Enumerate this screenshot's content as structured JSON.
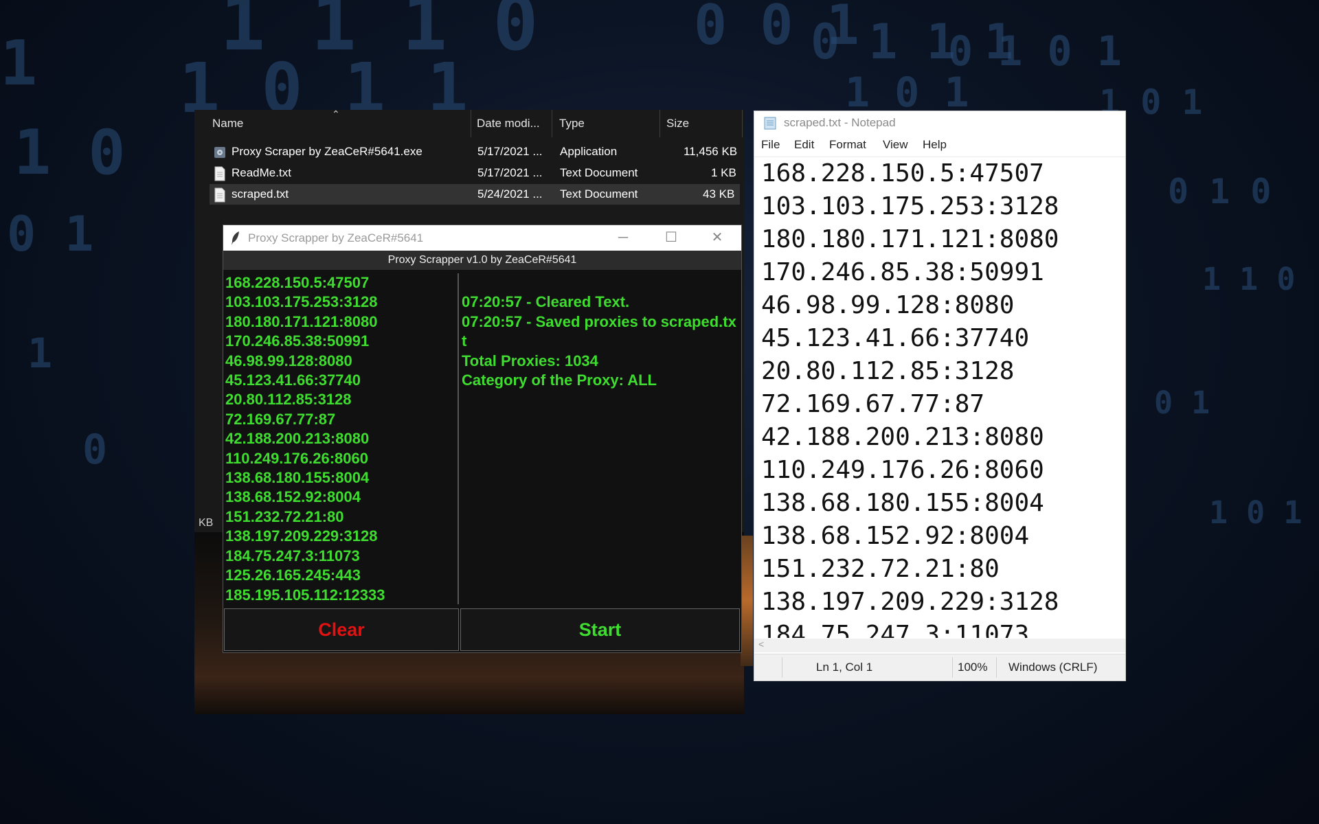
{
  "explorer": {
    "columns": [
      "Name",
      "Date modi...",
      "Type",
      "Size"
    ],
    "files": [
      {
        "name": "Proxy Scraper by ZeaCeR#5641.exe",
        "date": "5/17/2021 ...",
        "type": "Application",
        "size": "11,456 KB",
        "icon": "app-icon"
      },
      {
        "name": "ReadMe.txt",
        "date": "5/17/2021 ...",
        "type": "Text Document",
        "size": "1 KB",
        "icon": "text-file-icon"
      },
      {
        "name": "scraped.txt",
        "date": "5/24/2021 ...",
        "type": "Text Document",
        "size": "43 KB",
        "icon": "text-file-icon"
      }
    ],
    "partial_size": "KB"
  },
  "proxy_app": {
    "title": "Proxy Scrapper by ZeaCeR#5641",
    "subtitle": "Proxy Scrapper v1.0 by ZeaCeR#5641",
    "proxies": [
      "168.228.150.5:47507",
      "103.103.175.253:3128",
      "180.180.171.121:8080",
      "170.246.85.38:50991",
      "46.98.99.128:8080",
      "45.123.41.66:37740",
      "20.80.112.85:3128",
      "72.169.67.77:87",
      "42.188.200.213:8080",
      "110.249.176.26:8060",
      "138.68.180.155:8004",
      "138.68.152.92:8004",
      "151.232.72.21:80",
      "138.197.209.229:3128",
      "184.75.247.3:11073",
      "125.26.165.245:443",
      "185.195.105.112:12333"
    ],
    "log": [
      "",
      "07:20:57 - Cleared Text.",
      "07:20:57 - Saved proxies to scraped.txt",
      "Total Proxies: 1034",
      "Category of the Proxy: ALL"
    ],
    "clear_label": "Clear",
    "start_label": "Start",
    "colors": {
      "text": "#3fdd2f",
      "clear": "#e01212",
      "start": "#3fdd2f"
    }
  },
  "notepad": {
    "title": "scraped.txt - Notepad",
    "menu": [
      "File",
      "Edit",
      "Format",
      "View",
      "Help"
    ],
    "lines": [
      "168.228.150.5:47507",
      "103.103.175.253:3128",
      "180.180.171.121:8080",
      "170.246.85.38:50991",
      "46.98.99.128:8080",
      "45.123.41.66:37740",
      "20.80.112.85:3128",
      "72.169.67.77:87",
      "42.188.200.213:8080",
      "110.249.176.26:8060",
      "138.68.180.155:8004",
      "138.68.152.92:8004",
      "151.232.72.21:80",
      "138.197.209.229:3128",
      "184.75.247.3:11073"
    ],
    "status": {
      "position": "Ln 1, Col 1",
      "zoom": "100%",
      "encoding": "Windows (CRLF)"
    }
  }
}
